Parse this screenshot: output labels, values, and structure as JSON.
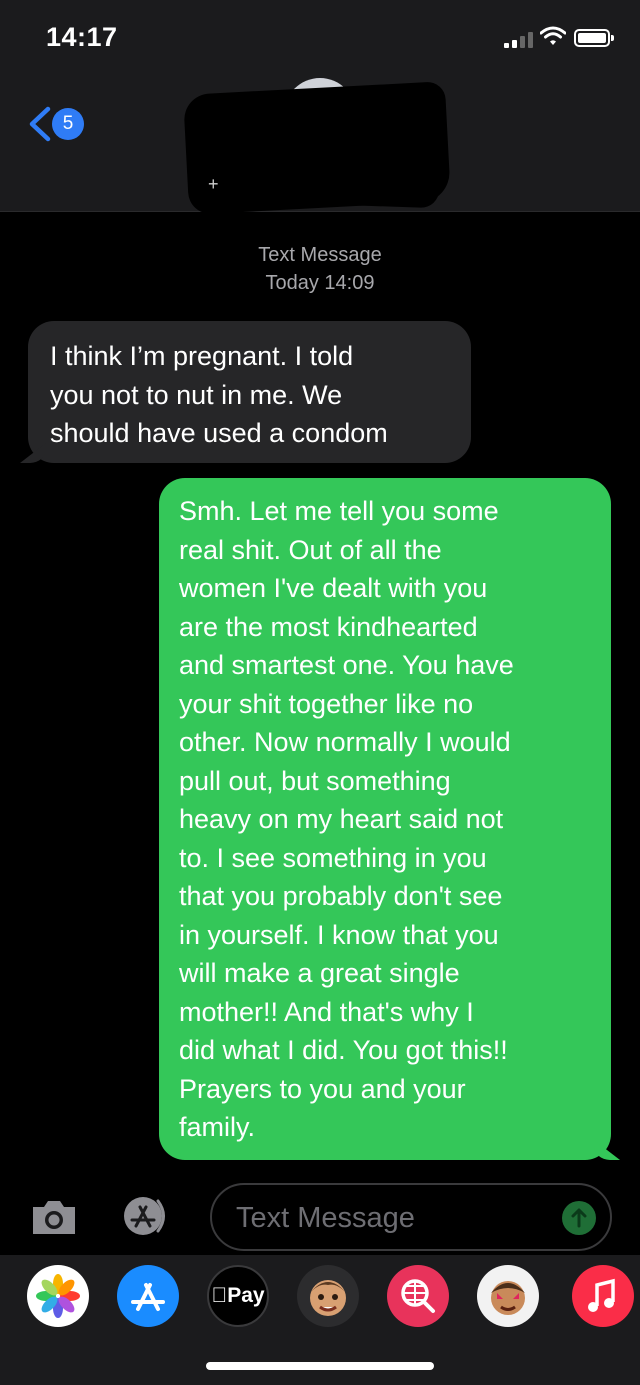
{
  "status_bar": {
    "time": "14:17"
  },
  "nav": {
    "back_count": "5"
  },
  "conversation": {
    "service_label": "Text Message",
    "timestamp": "Today 14:09",
    "messages": [
      {
        "direction": "incoming",
        "text": "I think I’m pregnant. I told\nyou not to nut in me. We\nshould have used a condom"
      },
      {
        "direction": "outgoing",
        "text": "Smh. Let me tell you some\nreal shit. Out of all the\nwomen I've dealt with you\nare the most kindhearted\nand smartest one. You have\nyour shit together like no\nother. Now normally I would\npull out, but something\nheavy on my heart said not\nto. I see something in you\nthat you probably don't see\nin yourself. I know that you\nwill make a great single\nmother!!  And that's why I\ndid what I did. You got this!!\nPrayers to you and your\nfamily."
      }
    ]
  },
  "composer": {
    "placeholder": "Text Message"
  },
  "app_drawer": {
    "applepay_label": "Pay",
    "apps": [
      "photos-icon",
      "appstore-icon",
      "applepay-icon",
      "memoji-icon",
      "web-search-icon",
      "animoji-icon",
      "music-icon"
    ]
  },
  "colors": {
    "outgoing_bubble": "#34c759",
    "incoming_bubble": "#262628",
    "accent": "#2f7cf6"
  }
}
